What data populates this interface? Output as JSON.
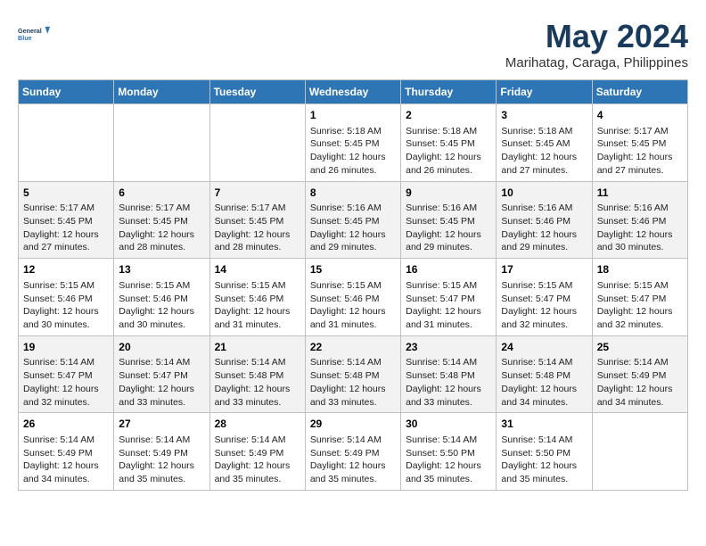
{
  "header": {
    "logo_line1": "General",
    "logo_line2": "Blue",
    "month_title": "May 2024",
    "subtitle": "Marihatag, Caraga, Philippines"
  },
  "weekdays": [
    "Sunday",
    "Monday",
    "Tuesday",
    "Wednesday",
    "Thursday",
    "Friday",
    "Saturday"
  ],
  "weeks": [
    [
      {
        "day": "",
        "info": ""
      },
      {
        "day": "",
        "info": ""
      },
      {
        "day": "",
        "info": ""
      },
      {
        "day": "1",
        "info": "Sunrise: 5:18 AM\nSunset: 5:45 PM\nDaylight: 12 hours\nand 26 minutes."
      },
      {
        "day": "2",
        "info": "Sunrise: 5:18 AM\nSunset: 5:45 PM\nDaylight: 12 hours\nand 26 minutes."
      },
      {
        "day": "3",
        "info": "Sunrise: 5:18 AM\nSunset: 5:45 AM\nDaylight: 12 hours\nand 27 minutes."
      },
      {
        "day": "4",
        "info": "Sunrise: 5:17 AM\nSunset: 5:45 PM\nDaylight: 12 hours\nand 27 minutes."
      }
    ],
    [
      {
        "day": "5",
        "info": "Sunrise: 5:17 AM\nSunset: 5:45 PM\nDaylight: 12 hours\nand 27 minutes."
      },
      {
        "day": "6",
        "info": "Sunrise: 5:17 AM\nSunset: 5:45 PM\nDaylight: 12 hours\nand 28 minutes."
      },
      {
        "day": "7",
        "info": "Sunrise: 5:17 AM\nSunset: 5:45 PM\nDaylight: 12 hours\nand 28 minutes."
      },
      {
        "day": "8",
        "info": "Sunrise: 5:16 AM\nSunset: 5:45 PM\nDaylight: 12 hours\nand 29 minutes."
      },
      {
        "day": "9",
        "info": "Sunrise: 5:16 AM\nSunset: 5:45 PM\nDaylight: 12 hours\nand 29 minutes."
      },
      {
        "day": "10",
        "info": "Sunrise: 5:16 AM\nSunset: 5:46 PM\nDaylight: 12 hours\nand 29 minutes."
      },
      {
        "day": "11",
        "info": "Sunrise: 5:16 AM\nSunset: 5:46 PM\nDaylight: 12 hours\nand 30 minutes."
      }
    ],
    [
      {
        "day": "12",
        "info": "Sunrise: 5:15 AM\nSunset: 5:46 PM\nDaylight: 12 hours\nand 30 minutes."
      },
      {
        "day": "13",
        "info": "Sunrise: 5:15 AM\nSunset: 5:46 PM\nDaylight: 12 hours\nand 30 minutes."
      },
      {
        "day": "14",
        "info": "Sunrise: 5:15 AM\nSunset: 5:46 PM\nDaylight: 12 hours\nand 31 minutes."
      },
      {
        "day": "15",
        "info": "Sunrise: 5:15 AM\nSunset: 5:46 PM\nDaylight: 12 hours\nand 31 minutes."
      },
      {
        "day": "16",
        "info": "Sunrise: 5:15 AM\nSunset: 5:47 PM\nDaylight: 12 hours\nand 31 minutes."
      },
      {
        "day": "17",
        "info": "Sunrise: 5:15 AM\nSunset: 5:47 PM\nDaylight: 12 hours\nand 32 minutes."
      },
      {
        "day": "18",
        "info": "Sunrise: 5:15 AM\nSunset: 5:47 PM\nDaylight: 12 hours\nand 32 minutes."
      }
    ],
    [
      {
        "day": "19",
        "info": "Sunrise: 5:14 AM\nSunset: 5:47 PM\nDaylight: 12 hours\nand 32 minutes."
      },
      {
        "day": "20",
        "info": "Sunrise: 5:14 AM\nSunset: 5:47 PM\nDaylight: 12 hours\nand 33 minutes."
      },
      {
        "day": "21",
        "info": "Sunrise: 5:14 AM\nSunset: 5:48 PM\nDaylight: 12 hours\nand 33 minutes."
      },
      {
        "day": "22",
        "info": "Sunrise: 5:14 AM\nSunset: 5:48 PM\nDaylight: 12 hours\nand 33 minutes."
      },
      {
        "day": "23",
        "info": "Sunrise: 5:14 AM\nSunset: 5:48 PM\nDaylight: 12 hours\nand 33 minutes."
      },
      {
        "day": "24",
        "info": "Sunrise: 5:14 AM\nSunset: 5:48 PM\nDaylight: 12 hours\nand 34 minutes."
      },
      {
        "day": "25",
        "info": "Sunrise: 5:14 AM\nSunset: 5:49 PM\nDaylight: 12 hours\nand 34 minutes."
      }
    ],
    [
      {
        "day": "26",
        "info": "Sunrise: 5:14 AM\nSunset: 5:49 PM\nDaylight: 12 hours\nand 34 minutes."
      },
      {
        "day": "27",
        "info": "Sunrise: 5:14 AM\nSunset: 5:49 PM\nDaylight: 12 hours\nand 35 minutes."
      },
      {
        "day": "28",
        "info": "Sunrise: 5:14 AM\nSunset: 5:49 PM\nDaylight: 12 hours\nand 35 minutes."
      },
      {
        "day": "29",
        "info": "Sunrise: 5:14 AM\nSunset: 5:49 PM\nDaylight: 12 hours\nand 35 minutes."
      },
      {
        "day": "30",
        "info": "Sunrise: 5:14 AM\nSunset: 5:50 PM\nDaylight: 12 hours\nand 35 minutes."
      },
      {
        "day": "31",
        "info": "Sunrise: 5:14 AM\nSunset: 5:50 PM\nDaylight: 12 hours\nand 35 minutes."
      },
      {
        "day": "",
        "info": ""
      }
    ]
  ]
}
